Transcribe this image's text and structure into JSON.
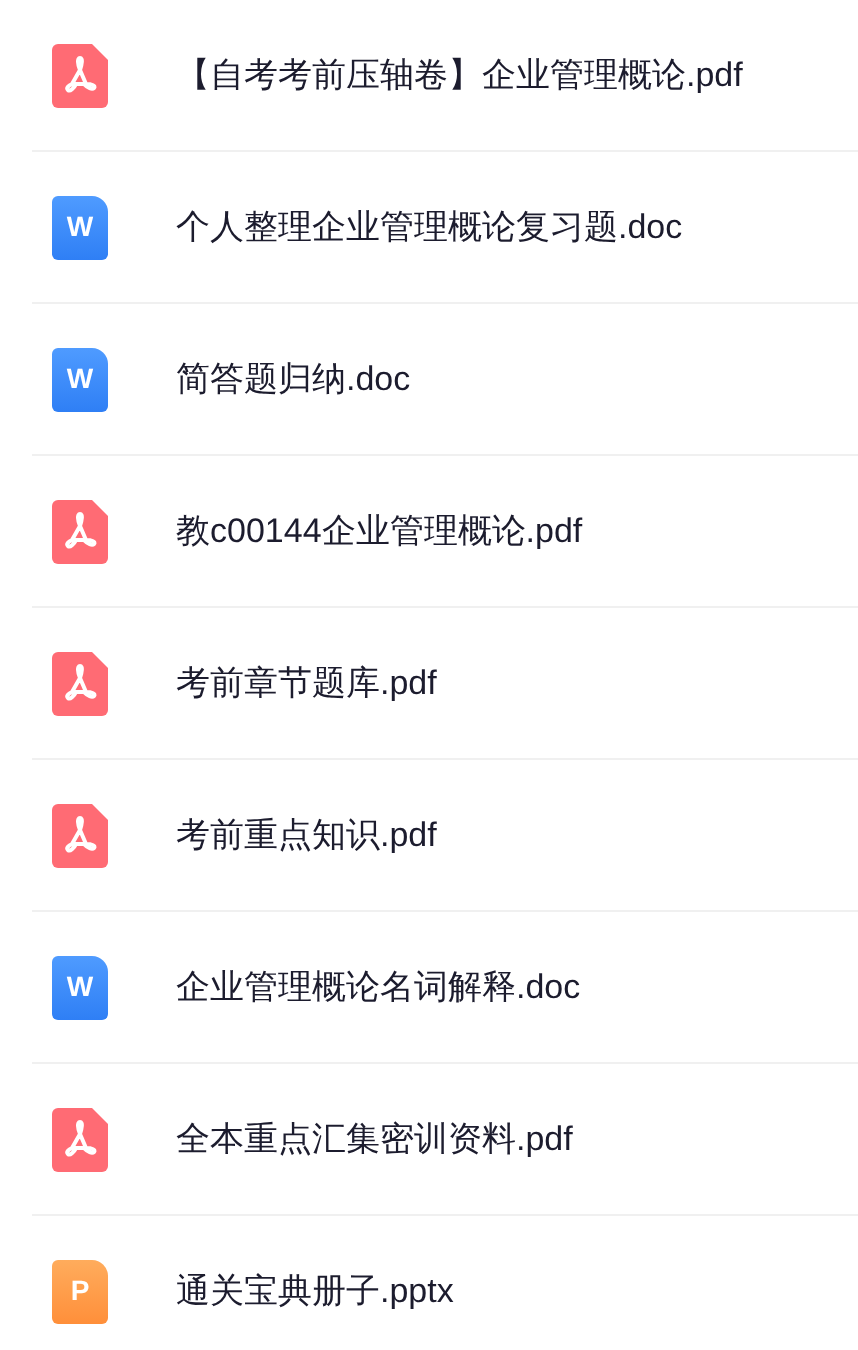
{
  "files": [
    {
      "kind": "pdf",
      "name": "【自考考前压轴卷】企业管理概论.pdf"
    },
    {
      "kind": "doc",
      "letter": "W",
      "name": "个人整理企业管理概论复习题.doc"
    },
    {
      "kind": "doc",
      "letter": "W",
      "name": "简答题归纳.doc"
    },
    {
      "kind": "pdf",
      "name": "教c00144企业管理概论.pdf"
    },
    {
      "kind": "pdf",
      "name": "考前章节题库.pdf"
    },
    {
      "kind": "pdf",
      "name": "考前重点知识.pdf"
    },
    {
      "kind": "doc",
      "letter": "W",
      "name": "企业管理概论名词解释.doc"
    },
    {
      "kind": "pdf",
      "name": "全本重点汇集密训资料.pdf"
    },
    {
      "kind": "ppt",
      "letter": "P",
      "name": "通关宝典册子.pptx"
    }
  ]
}
